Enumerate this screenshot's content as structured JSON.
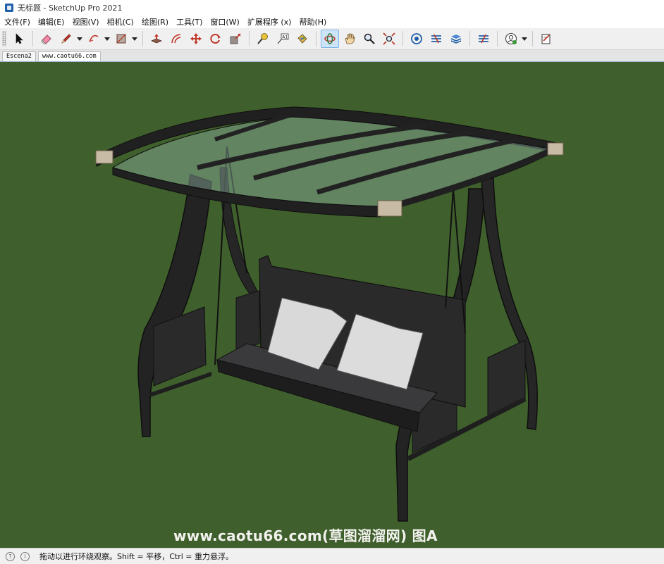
{
  "window": {
    "title": "无标题 - SketchUp Pro 2021",
    "app_icon": "sketchup-logo-icon"
  },
  "menu": [
    {
      "label": "文件(F)"
    },
    {
      "label": "编辑(E)"
    },
    {
      "label": "视图(V)"
    },
    {
      "label": "相机(C)"
    },
    {
      "label": "绘图(R)"
    },
    {
      "label": "工具(T)"
    },
    {
      "label": "窗口(W)"
    },
    {
      "label": "扩展程序 (x)"
    },
    {
      "label": "帮助(H)"
    }
  ],
  "toolbar": {
    "tools": [
      "select-icon",
      "eraser-icon",
      "pencil-line-icon",
      "arc-icon",
      "rectangle-icon",
      "push-pull-icon",
      "offset-icon",
      "move-icon",
      "rotate-icon",
      "scale-icon",
      "tape-measure-icon",
      "text-label-icon",
      "paint-bucket-icon",
      "orbit-icon",
      "pan-icon",
      "zoom-icon",
      "zoom-extents-icon",
      "3d-warehouse-icon",
      "extension-warehouse-icon",
      "layout-icon",
      "sketchup-send-icon",
      "account-icon",
      "clip-icon"
    ],
    "active_tool": "orbit-icon"
  },
  "scenes": {
    "tabs": [
      {
        "label": "Escena2"
      },
      {
        "label": "www.caotu66.com"
      }
    ],
    "active_index": 1
  },
  "viewport": {
    "background_color": "#3f5f2c",
    "watermark": "www.caotu66.com(草图溜溜网) 图A"
  },
  "status": {
    "message": "拖动以进行环绕观察。Shift = 平移，Ctrl = 重力悬浮。"
  }
}
